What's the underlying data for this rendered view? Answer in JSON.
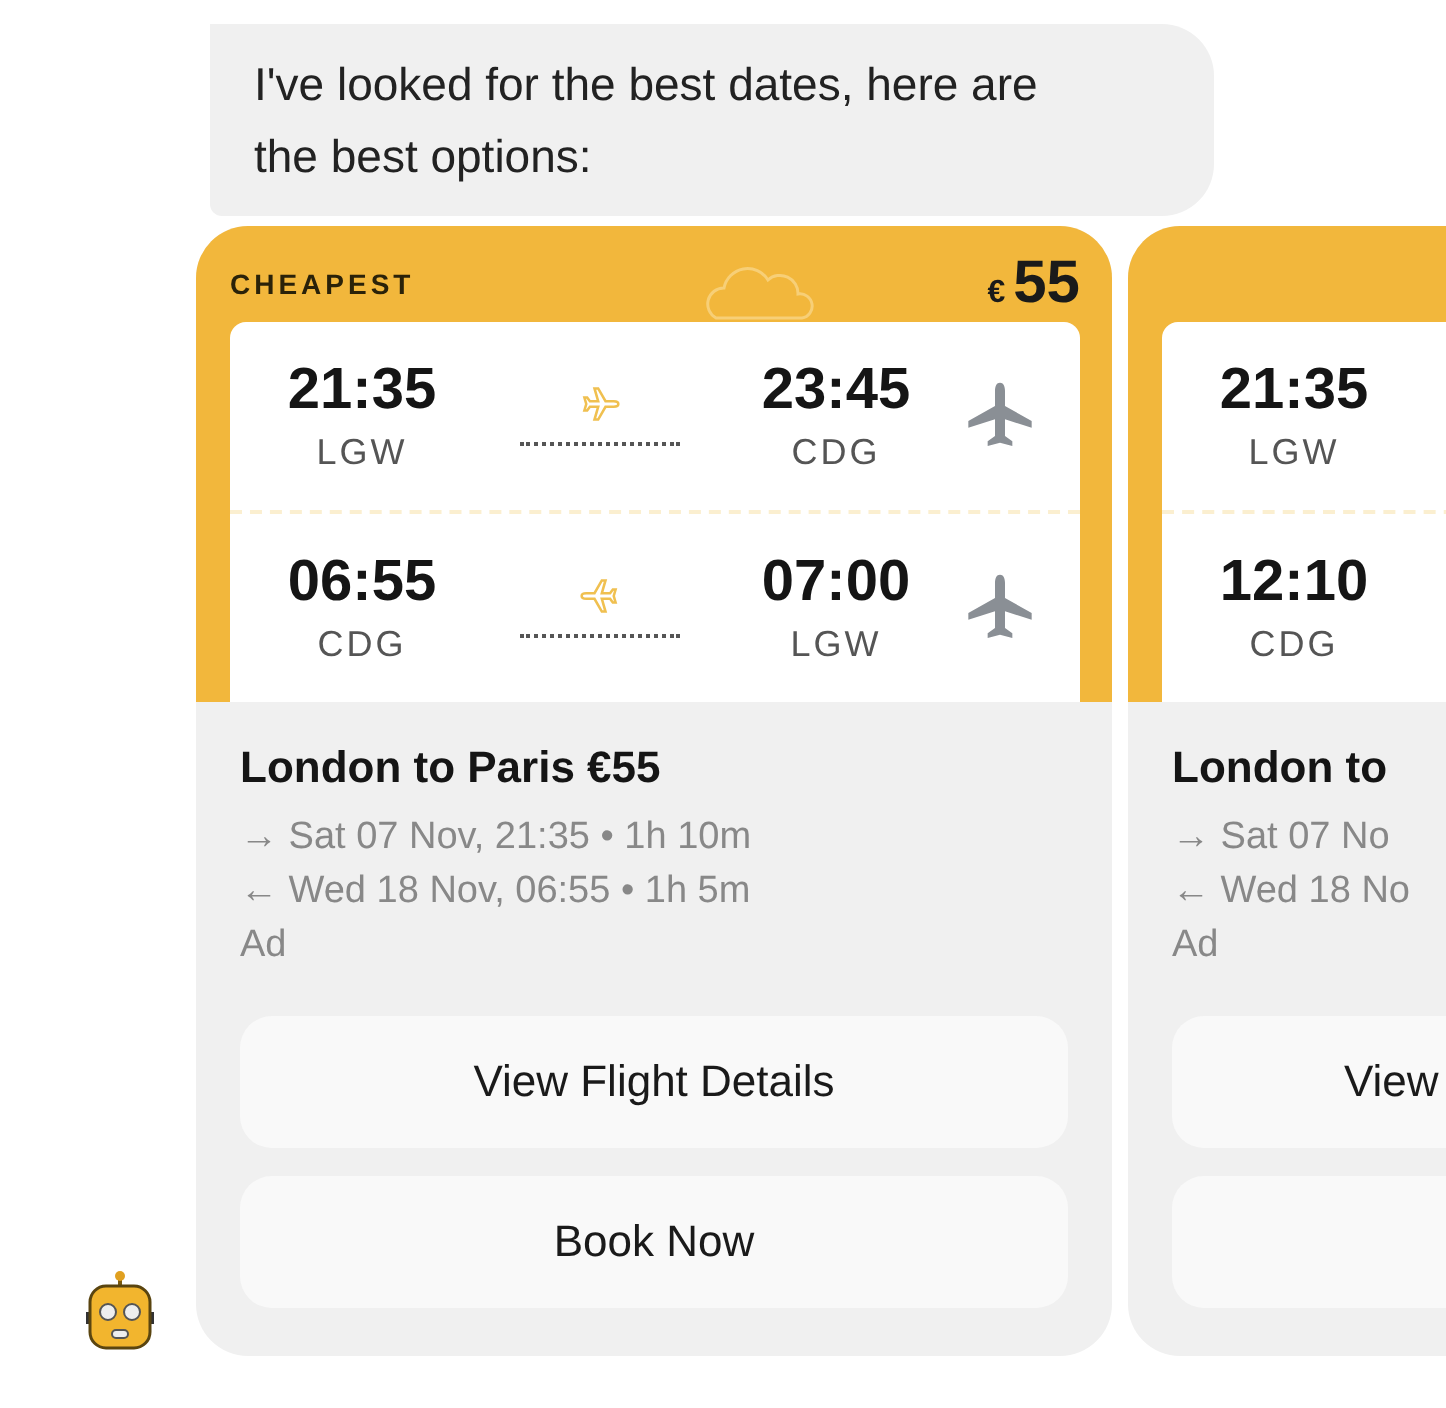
{
  "message": {
    "text": "I've looked for the best dates, here are the best options:"
  },
  "offers": [
    {
      "badge": "CHEAPEST",
      "currency": "€",
      "price": "55",
      "legs": [
        {
          "kind": "outbound",
          "depart_time": "21:35",
          "depart_airport": "LGW",
          "arrive_time": "23:45",
          "arrive_airport": "CDG"
        },
        {
          "kind": "return",
          "depart_time": "06:55",
          "depart_airport": "CDG",
          "arrive_time": "07:00",
          "arrive_airport": "LGW"
        }
      ],
      "title": "London to Paris €55",
      "details": [
        "→ Sat 07 Nov, 21:35 • 1h 10m",
        "← Wed 18 Nov, 06:55 • 1h 5m"
      ],
      "sponsor_label": "Ad",
      "buttons": [
        {
          "kind": "text",
          "label": "View Flight Details"
        },
        {
          "kind": "text",
          "label": "Book Now"
        }
      ]
    },
    {
      "legs": [
        {
          "depart_time": "21:35",
          "depart_airport": "LGW"
        },
        {
          "depart_time": "12:10",
          "depart_airport": "CDG"
        }
      ],
      "title": "London to",
      "details": [
        "→ Sat 07 No",
        "← Wed 18 No"
      ],
      "sponsor_label": "Ad",
      "buttons": [
        {
          "kind": "text",
          "label": "View"
        },
        {
          "kind": "blank"
        }
      ]
    }
  ]
}
